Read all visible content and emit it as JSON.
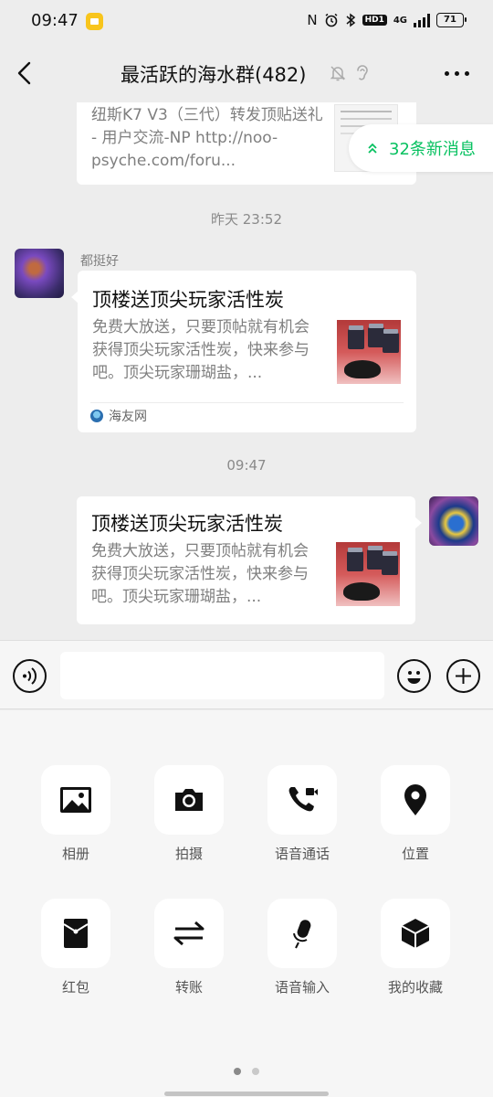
{
  "status": {
    "time": "09:47",
    "hd_badge": "HD1",
    "network": "4G",
    "battery": "71"
  },
  "header": {
    "title": "最活跃的海水群(482)"
  },
  "chat": {
    "new_messages": "32条新消息",
    "messages": [
      {
        "desc": "纽斯K7 V3（三代）转发顶贴送礼 - 用户交流-NP http://noo-psyche.com/foru..."
      },
      {
        "timestamp": "昨天 23:52",
        "sender": "都挺好",
        "title": "顶楼送顶尖玩家活性炭",
        "desc": "免费大放送，只要顶帖就有机会获得顶尖玩家活性炭，快来参与吧。顶尖玩家珊瑚盐，...",
        "source": "海友网"
      },
      {
        "timestamp": "09:47",
        "title": "顶楼送顶尖玩家活性炭",
        "desc": "免费大放送，只要顶帖就有机会获得顶尖玩家活性炭，快来参与吧。顶尖玩家珊瑚盐，..."
      }
    ]
  },
  "input": {
    "placeholder": ""
  },
  "panel": {
    "tools": [
      {
        "label": "相册",
        "icon": "photo-icon"
      },
      {
        "label": "拍摄",
        "icon": "camera-icon"
      },
      {
        "label": "语音通话",
        "icon": "voice-call-icon"
      },
      {
        "label": "位置",
        "icon": "location-icon"
      },
      {
        "label": "红包",
        "icon": "red-packet-icon"
      },
      {
        "label": "转账",
        "icon": "transfer-icon"
      },
      {
        "label": "语音输入",
        "icon": "microphone-icon"
      },
      {
        "label": "我的收藏",
        "icon": "favorites-cube-icon"
      }
    ],
    "page_count": 2,
    "active_page": 1
  },
  "colors": {
    "accent_green": "#07c160",
    "background": "#ededed",
    "panel_background": "#f6f6f6"
  }
}
